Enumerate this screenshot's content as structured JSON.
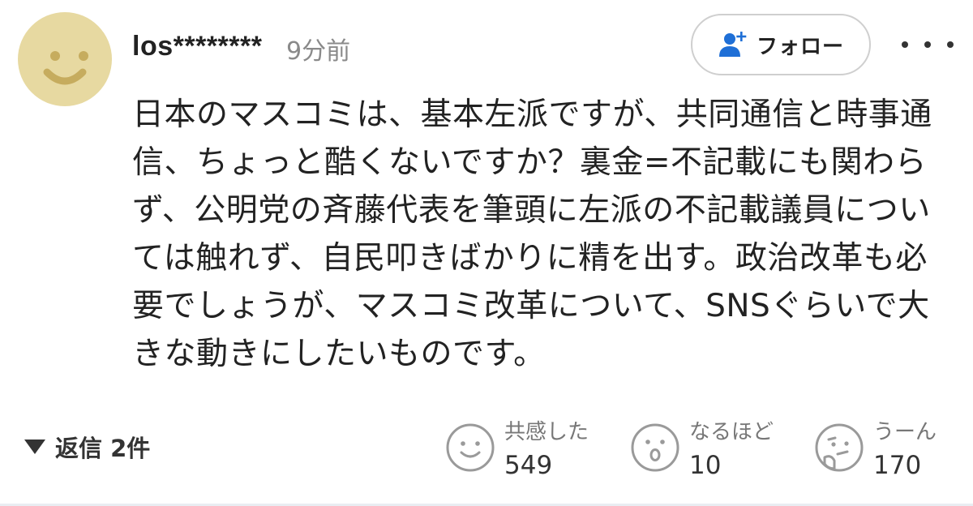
{
  "comment": {
    "username": "los********",
    "timestamp": "9分前",
    "follow_label": "フォロー",
    "text": "日本のマスコミは、基本左派ですが、共同通信と時事通信、ちょっと酷くないですか？裏金=不記載にも関わらず、公明党の斉藤代表を筆頭に左派の不記載議員については触れず、自民叩きばかりに精を出す。政治改革も必要でしょうが、マスコミ改革について、SNSぐらいで大きな動きにしたいものです。",
    "replies_label": "返信 2件"
  },
  "reactions": [
    {
      "label": "共感した",
      "count": "549",
      "icon": "smile-face-icon"
    },
    {
      "label": "なるほど",
      "count": "10",
      "icon": "surprised-face-icon"
    },
    {
      "label": "うーん",
      "count": "170",
      "icon": "thinking-face-icon"
    }
  ],
  "colors": {
    "avatar_bg": "#e7d9a1",
    "avatar_feature": "#c6ac5e",
    "follow_icon": "#1f6fd6",
    "text": "#222222",
    "muted": "#8a8a8a",
    "reaction_icon": "#9a9a9a"
  },
  "icons": {
    "avatar": "smiley-avatar-icon",
    "follow": "add-person-icon",
    "more": "more-dots-icon",
    "replies": "triangle-down-icon"
  }
}
